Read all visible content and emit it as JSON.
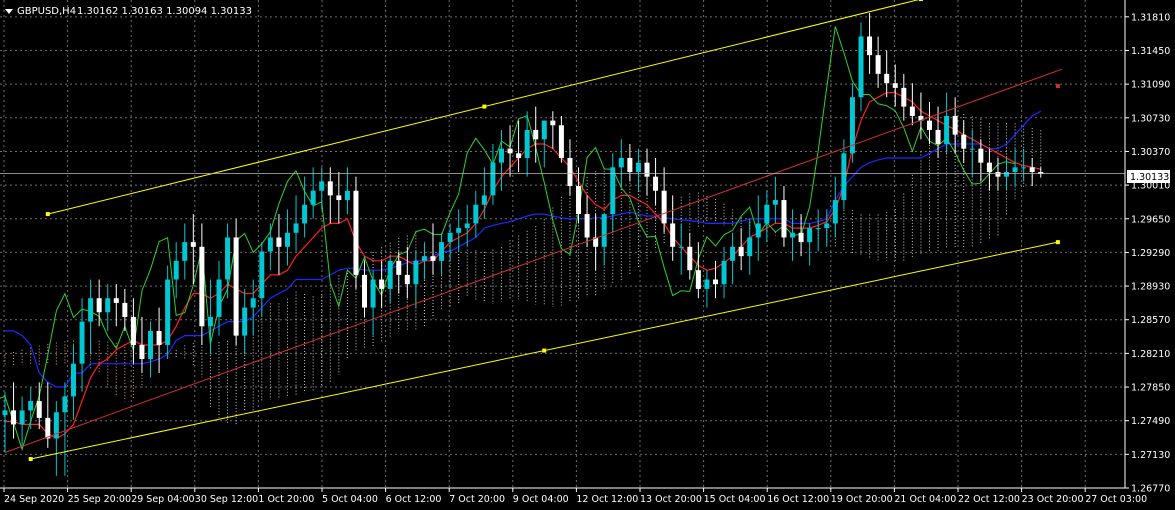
{
  "header": {
    "symbol": "GBPUSD,H4",
    "ohlc": "1.30162 1.30163 1.30094 1.30133"
  },
  "current_price_label": "1.30133",
  "colors": {
    "background": "#000000",
    "grid": "#6e6e6e",
    "axis": "#ffffff",
    "bull": "#00c8d2",
    "bear": "#ffffff",
    "channel": "#ffff00",
    "trend": "#d23030",
    "tenkan": "#ff2020",
    "kijun": "#1a2cff",
    "chikou": "#30d030",
    "kumo_up": "#cccccc",
    "kumo_down": "#ff9966"
  },
  "chart_data": {
    "type": "candlestick",
    "y_ticks": [
      "1.31810",
      "1.31450",
      "1.31090",
      "1.30730",
      "1.30370",
      "1.30010",
      "1.29650",
      "1.29290",
      "1.28930",
      "1.28570",
      "1.28210",
      "1.27850",
      "1.27490",
      "1.27130",
      "1.26770"
    ],
    "ylim": [
      1.2677,
      1.3199
    ],
    "x_ticks": [
      "24 Sep 2020",
      "25 Sep 20:00",
      "29 Sep 04:00",
      "30 Sep 12:00",
      "1 Oct 20:00",
      "5 Oct 04:00",
      "6 Oct 12:00",
      "7 Oct 20:00",
      "9 Oct 04:00",
      "12 Oct 12:00",
      "13 Oct 20:00",
      "15 Oct 04:00",
      "16 Oct 12:00",
      "19 Oct 20:00",
      "21 Oct 04:00",
      "22 Oct 12:00",
      "23 Oct 20:00",
      "27 Oct 03:00"
    ],
    "current_price": 1.30133,
    "candles": {
      "open": [
        1.2755,
        1.276,
        1.2745,
        1.276,
        1.277,
        1.2752,
        1.273,
        1.2758,
        1.2775,
        1.281,
        1.2855,
        1.288,
        1.2865,
        1.288,
        1.2875,
        1.286,
        1.283,
        1.2815,
        1.2845,
        1.283,
        1.29,
        1.292,
        1.294,
        1.2935,
        1.285,
        1.286,
        1.29,
        1.2945,
        1.284,
        1.287,
        1.288,
        1.293,
        1.2945,
        1.2935,
        1.295,
        1.296,
        1.298,
        1.2995,
        1.3005,
        1.299,
        1.2985,
        1.2995,
        1.2905,
        1.287,
        1.29,
        1.289,
        1.292,
        1.2905,
        1.2895,
        1.292,
        1.2925,
        1.292,
        1.294,
        1.295,
        1.2955,
        1.296,
        1.298,
        1.299,
        1.3025,
        1.304,
        1.3035,
        1.303,
        1.306,
        1.305,
        1.307,
        1.3065,
        1.303,
        1.3,
        1.297,
        1.2945,
        1.2935,
        1.297,
        1.302,
        1.303,
        1.3015,
        1.3025,
        1.301,
        1.2995,
        1.296,
        1.2935,
        1.2935,
        1.291,
        1.289,
        1.29,
        1.2895,
        1.292,
        1.2935,
        1.2925,
        1.2945,
        1.296,
        1.298,
        1.2985,
        1.2945,
        1.295,
        1.294,
        1.2955,
        1.2955,
        1.296,
        1.2985,
        1.3035,
        1.3095,
        1.316,
        1.314,
        1.312,
        1.311,
        1.3105,
        1.3085,
        1.3075,
        1.307,
        1.306,
        1.3045,
        1.3075,
        1.3055,
        1.304,
        1.304,
        1.3025,
        1.3015,
        1.301,
        1.3015,
        1.302,
        1.302,
        1.3015
      ],
      "high": [
        1.278,
        1.279,
        1.2775,
        1.2785,
        1.279,
        1.279,
        1.277,
        1.279,
        1.283,
        1.288,
        1.29,
        1.29,
        1.2895,
        1.2895,
        1.289,
        1.288,
        1.286,
        1.2855,
        1.287,
        1.2915,
        1.294,
        1.296,
        1.297,
        1.296,
        1.29,
        1.292,
        1.296,
        1.2965,
        1.289,
        1.29,
        1.294,
        1.296,
        1.297,
        1.2975,
        1.299,
        1.301,
        1.302,
        1.302,
        1.302,
        1.3015,
        1.302,
        1.301,
        1.292,
        1.291,
        1.292,
        1.2925,
        1.293,
        1.2935,
        1.293,
        1.294,
        1.296,
        1.295,
        1.296,
        1.2975,
        1.298,
        1.2995,
        1.302,
        1.3045,
        1.306,
        1.3065,
        1.307,
        1.308,
        1.3085,
        1.307,
        1.308,
        1.3075,
        1.305,
        1.302,
        1.299,
        1.297,
        1.296,
        1.3035,
        1.305,
        1.3045,
        1.304,
        1.304,
        1.303,
        1.302,
        1.299,
        1.296,
        1.295,
        1.294,
        1.291,
        1.292,
        1.2935,
        1.295,
        1.2955,
        1.2965,
        1.299,
        1.2995,
        1.301,
        1.3,
        1.2975,
        1.297,
        1.296,
        1.2975,
        1.2975,
        1.301,
        1.305,
        1.311,
        1.3175,
        1.3185,
        1.316,
        1.3145,
        1.313,
        1.312,
        1.311,
        1.31,
        1.309,
        1.3085,
        1.31,
        1.3095,
        1.307,
        1.306,
        1.305,
        1.304,
        1.303,
        1.303,
        1.304,
        1.304,
        1.303,
        1.302
      ],
      "low": [
        1.2715,
        1.273,
        1.272,
        1.274,
        1.274,
        1.272,
        1.269,
        1.269,
        1.275,
        1.278,
        1.282,
        1.285,
        1.2845,
        1.285,
        1.2845,
        1.281,
        1.28,
        1.2795,
        1.28,
        1.2815,
        1.288,
        1.29,
        1.2895,
        1.283,
        1.282,
        1.284,
        1.288,
        1.283,
        1.282,
        1.284,
        1.286,
        1.291,
        1.2905,
        1.2915,
        1.293,
        1.2945,
        1.2965,
        1.2975,
        1.296,
        1.296,
        1.297,
        1.289,
        1.286,
        1.284,
        1.287,
        1.2875,
        1.2885,
        1.288,
        1.287,
        1.29,
        1.2905,
        1.2905,
        1.292,
        1.293,
        1.2935,
        1.2945,
        1.2965,
        1.298,
        1.2995,
        1.301,
        1.3015,
        1.301,
        1.3025,
        1.302,
        1.304,
        1.3025,
        1.299,
        1.296,
        1.2935,
        1.291,
        1.2915,
        1.295,
        1.3,
        1.3005,
        1.2995,
        1.299,
        1.298,
        1.295,
        1.292,
        1.2905,
        1.29,
        1.288,
        1.287,
        1.288,
        1.288,
        1.2895,
        1.291,
        1.2905,
        1.292,
        1.294,
        1.296,
        1.2935,
        1.292,
        1.2925,
        1.2915,
        1.293,
        1.2935,
        1.2945,
        1.2975,
        1.3025,
        1.308,
        1.312,
        1.3105,
        1.3095,
        1.3085,
        1.307,
        1.3065,
        1.305,
        1.3045,
        1.303,
        1.3035,
        1.3035,
        1.3025,
        1.301,
        1.3005,
        1.2995,
        1.2995,
        1.2995,
        1.3,
        1.3005,
        1.3,
        1.3009
      ],
      "close": [
        1.276,
        1.2745,
        1.276,
        1.277,
        1.2752,
        1.273,
        1.2758,
        1.2775,
        1.281,
        1.2855,
        1.288,
        1.2865,
        1.288,
        1.2875,
        1.286,
        1.283,
        1.2815,
        1.2845,
        1.283,
        1.29,
        1.292,
        1.294,
        1.2935,
        1.285,
        1.286,
        1.29,
        1.2945,
        1.284,
        1.287,
        1.288,
        1.293,
        1.2945,
        1.2935,
        1.295,
        1.296,
        1.298,
        1.2995,
        1.3005,
        1.299,
        1.2985,
        1.2995,
        1.2905,
        1.287,
        1.29,
        1.289,
        1.292,
        1.2905,
        1.2895,
        1.292,
        1.2925,
        1.292,
        1.294,
        1.295,
        1.2955,
        1.296,
        1.298,
        1.299,
        1.3025,
        1.304,
        1.3035,
        1.303,
        1.306,
        1.305,
        1.307,
        1.3065,
        1.303,
        1.3,
        1.297,
        1.2945,
        1.2935,
        1.297,
        1.302,
        1.303,
        1.3015,
        1.3025,
        1.301,
        1.2995,
        1.296,
        1.2935,
        1.2935,
        1.291,
        1.289,
        1.29,
        1.2895,
        1.292,
        1.2935,
        1.2925,
        1.2945,
        1.296,
        1.298,
        1.2985,
        1.2945,
        1.295,
        1.294,
        1.2955,
        1.2955,
        1.296,
        1.2985,
        1.3035,
        1.3095,
        1.316,
        1.314,
        1.312,
        1.311,
        1.3105,
        1.3085,
        1.3075,
        1.307,
        1.306,
        1.3045,
        1.3075,
        1.3055,
        1.304,
        1.304,
        1.3025,
        1.3015,
        1.301,
        1.3015,
        1.302,
        1.302,
        1.3015,
        1.30133
      ]
    },
    "ichimoku": {
      "tenkan": [
        1.2748,
        1.2748,
        1.2745,
        1.2745,
        1.2745,
        1.2735,
        1.273,
        1.2735,
        1.2745,
        1.277,
        1.2795,
        1.281,
        1.2815,
        1.2825,
        1.283,
        1.2835,
        1.283,
        1.283,
        1.283,
        1.2835,
        1.285,
        1.287,
        1.2885,
        1.2885,
        1.288,
        1.2885,
        1.2895,
        1.289,
        1.2885,
        1.2885,
        1.2895,
        1.2905,
        1.2905,
        1.291,
        1.2925,
        1.2935,
        1.2945,
        1.2955,
        1.296,
        1.296,
        1.2965,
        1.294,
        1.2925,
        1.292,
        1.292,
        1.2925,
        1.2925,
        1.292,
        1.2915,
        1.292,
        1.292,
        1.293,
        1.294,
        1.2945,
        1.295,
        1.296,
        1.2975,
        1.2995,
        1.301,
        1.302,
        1.303,
        1.304,
        1.3045,
        1.3045,
        1.304,
        1.303,
        1.302,
        1.3005,
        1.299,
        1.298,
        1.2975,
        1.2985,
        1.299,
        1.299,
        1.2985,
        1.298,
        1.297,
        1.296,
        1.2945,
        1.2935,
        1.2925,
        1.2915,
        1.291,
        1.2912,
        1.2918,
        1.2925,
        1.2935,
        1.2945,
        1.295,
        1.2955,
        1.296,
        1.296,
        1.2955,
        1.2955,
        1.2955,
        1.2958,
        1.2962,
        1.2975,
        1.3,
        1.304,
        1.307,
        1.309,
        1.3095,
        1.31,
        1.31,
        1.3095,
        1.309,
        1.308,
        1.3075,
        1.307,
        1.3065,
        1.306,
        1.3055,
        1.305,
        1.3045,
        1.304,
        1.3035,
        1.303,
        1.3025,
        1.3022,
        1.302,
        1.3018
      ],
      "kijun": [
        1.2845,
        1.2845,
        1.284,
        1.283,
        1.28,
        1.279,
        1.2785,
        1.2785,
        1.28,
        1.28,
        1.281,
        1.281,
        1.281,
        1.281,
        1.281,
        1.281,
        1.281,
        1.2812,
        1.2815,
        1.282,
        1.2835,
        1.284,
        1.284,
        1.284,
        1.2845,
        1.285,
        1.2855,
        1.2855,
        1.2855,
        1.286,
        1.287,
        1.288,
        1.2885,
        1.289,
        1.29,
        1.29,
        1.29,
        1.29,
        1.2905,
        1.291,
        1.2912,
        1.2912,
        1.291,
        1.291,
        1.291,
        1.2912,
        1.2915,
        1.2918,
        1.292,
        1.292,
        1.2925,
        1.293,
        1.293,
        1.2935,
        1.294,
        1.2945,
        1.2955,
        1.2958,
        1.296,
        1.2962,
        1.2965,
        1.2968,
        1.297,
        1.297,
        1.2968,
        1.2966,
        1.2965,
        1.2965,
        1.2965,
        1.2966,
        1.2966,
        1.2968,
        1.297,
        1.2972,
        1.297,
        1.2968,
        1.2968,
        1.2966,
        1.2965,
        1.2964,
        1.2963,
        1.2962,
        1.296,
        1.296,
        1.296,
        1.296,
        1.2962,
        1.2965,
        1.2965,
        1.2965,
        1.2965,
        1.2965,
        1.296,
        1.296,
        1.296,
        1.2962,
        1.2965,
        1.2985,
        1.3,
        1.301,
        1.302,
        1.3025,
        1.3028,
        1.303,
        1.303,
        1.303,
        1.303,
        1.303,
        1.3035,
        1.304,
        1.3045,
        1.3045,
        1.3045,
        1.3045,
        1.3045,
        1.304,
        1.304,
        1.3045,
        1.3055,
        1.3065,
        1.3075,
        1.308
      ]
    },
    "trend_line": {
      "start": [
        0,
        1.2715
      ],
      "end": [
        123,
        1.3125
      ]
    },
    "channel": {
      "upper": {
        "start": [
          5,
          1.297
        ],
        "end": [
          107,
          1.32
        ]
      },
      "lower": {
        "start": [
          3,
          1.2708
        ],
        "end": [
          123,
          1.294
        ]
      }
    }
  },
  "x_axis_labels": [
    {
      "label": "24 Sep 2020"
    },
    {
      "label": "25 Sep 20:00"
    },
    {
      "label": "29 Sep 04:00"
    },
    {
      "label": "30 Sep 12:00"
    },
    {
      "label": "1 Oct 20:00"
    },
    {
      "label": "5 Oct 04:00"
    },
    {
      "label": "6 Oct 12:00"
    },
    {
      "label": "7 Oct 20:00"
    },
    {
      "label": "9 Oct 04:00"
    },
    {
      "label": "12 Oct 12:00"
    },
    {
      "label": "13 Oct 20:00"
    },
    {
      "label": "15 Oct 04:00"
    },
    {
      "label": "16 Oct 12:00"
    },
    {
      "label": "19 Oct 20:00"
    },
    {
      "label": "21 Oct 04:00"
    },
    {
      "label": "22 Oct 12:00"
    },
    {
      "label": "23 Oct 20:00"
    },
    {
      "label": "27 Oct 03:00"
    }
  ]
}
